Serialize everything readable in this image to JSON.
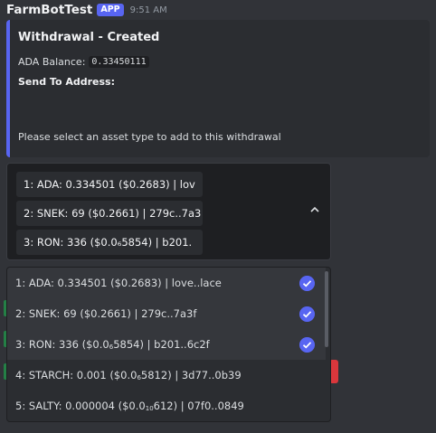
{
  "message": {
    "username": "FarmBotTest",
    "badge": "APP",
    "timestamp": "9:51 AM"
  },
  "embed": {
    "title": "Withdrawal - Created",
    "balance_label": "ADA Balance:",
    "balance_value": "0.33450111",
    "send_to_label": "Send To Address:",
    "footer": "Please select an asset type to add to this withdrawal",
    "accent_color": "#5865f2"
  },
  "select": {
    "selected_values": [
      "1: ADA: 0.334501 ($0.2683) | lov",
      "2: SNEK: 69 ($0.2661) | 279c..7a3",
      "3: RON: 336 ($0.0₆5854) | b201."
    ],
    "chevron_icon": "chevron-up-icon"
  },
  "menu": {
    "options": [
      {
        "label": "1: ADA: 0.334501 ($0.2683) | love..lace",
        "checked": true
      },
      {
        "label": "2: SNEK: 69 ($0.2661) | 279c..7a3f",
        "checked": true
      },
      {
        "label": "3: RON: 336 ($0.0₆5854) | b201..6c2f",
        "checked": true
      },
      {
        "label": "4: STARCH: 0.001 ($0.0₆5812) | 3d77..0b39",
        "checked": false
      },
      {
        "label": "5: SALTY: 0.000004 ($0.0₁₀612) | 07f0..0849",
        "checked": false
      }
    ]
  }
}
